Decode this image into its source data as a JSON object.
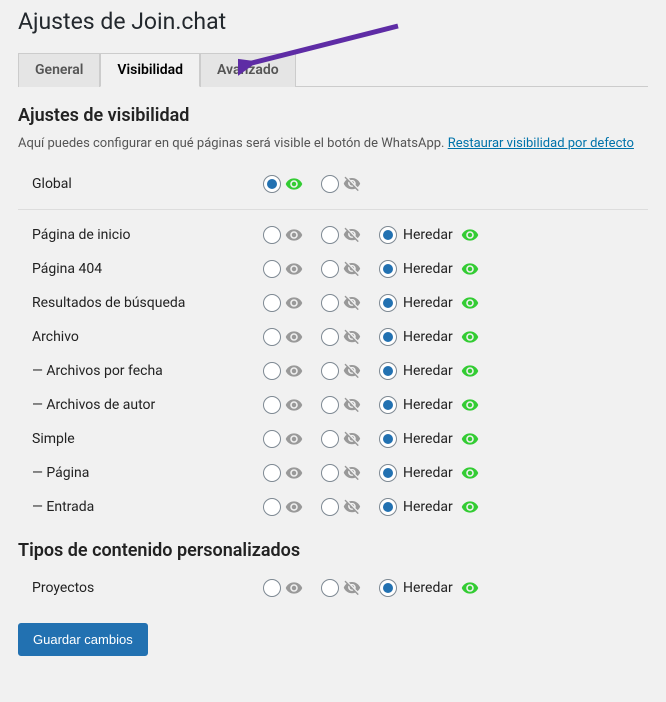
{
  "page_title": "Ajustes de Join.chat",
  "tabs": {
    "general": "General",
    "visibilidad": "Visibilidad",
    "avanzado": "Avanzado"
  },
  "section_title": "Ajustes de visibilidad",
  "description": "Aquí puedes configurar en qué páginas será visible el botón de WhatsApp. ",
  "restore_link": "Restaurar visibilidad por defecto",
  "rows_global": {
    "label": "Global"
  },
  "rows": [
    {
      "label": "Página de inicio"
    },
    {
      "label": "Página 404"
    },
    {
      "label": "Resultados de búsqueda"
    },
    {
      "label": "Archivo"
    },
    {
      "label": "— Archivos por fecha"
    },
    {
      "label": "— Archivos de autor"
    },
    {
      "label": "Simple"
    },
    {
      "label": "— Página"
    },
    {
      "label": "— Entrada"
    }
  ],
  "cpt_title": "Tipos de contenido personalizados",
  "cpt_rows": [
    {
      "label": "Proyectos"
    }
  ],
  "inherit_label": "Heredar",
  "submit_label": "Guardar cambios"
}
